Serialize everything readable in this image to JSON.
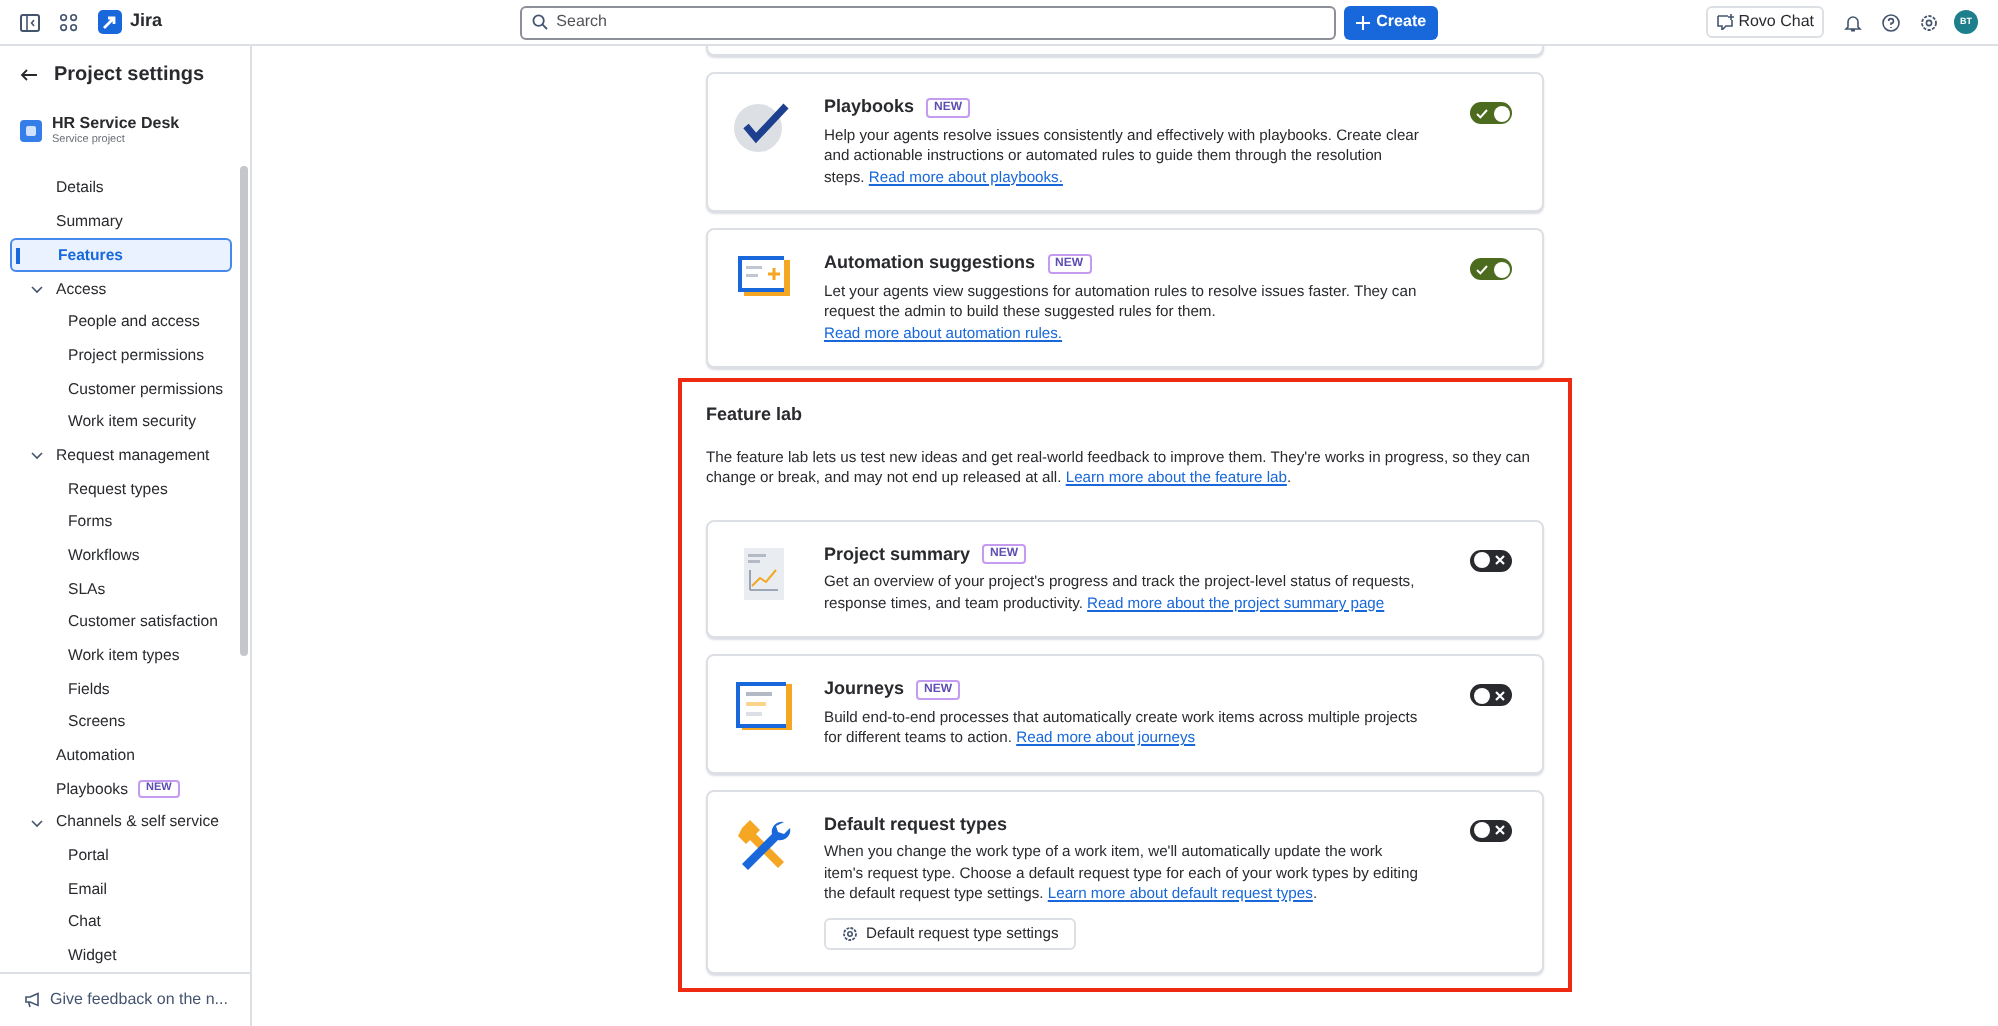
{
  "topbar": {
    "product": "Jira",
    "search": {
      "placeholder": "Search"
    },
    "create_button": "Create",
    "chat_button": "Rovo Chat",
    "avatar": "BT"
  },
  "sidebar": {
    "back_title": "Project settings",
    "project": {
      "name": "HR Service Desk",
      "type": "Service project"
    },
    "items": [
      {
        "label": "Details",
        "selected": false
      },
      {
        "label": "Summary",
        "selected": false
      },
      {
        "label": "Features",
        "selected": true
      },
      {
        "label": "Access",
        "selected": false,
        "expanded": true,
        "children": [
          {
            "label": "People and access",
            "selected": false
          },
          {
            "label": "Project permissions",
            "selected": false
          },
          {
            "label": "Customer permissions",
            "selected": false
          },
          {
            "label": "Work item security",
            "selected": false
          }
        ]
      },
      {
        "label": "Request management",
        "selected": false,
        "expanded": true,
        "children": [
          {
            "label": "Request types",
            "selected": false
          },
          {
            "label": "Forms",
            "selected": false
          },
          {
            "label": "Workflows",
            "selected": false
          },
          {
            "label": "SLAs",
            "selected": false
          },
          {
            "label": "Customer satisfaction",
            "selected": false
          },
          {
            "label": "Work item types",
            "selected": false
          },
          {
            "label": "Fields",
            "selected": false
          },
          {
            "label": "Screens",
            "selected": false
          }
        ]
      },
      {
        "label": "Automation",
        "selected": false
      },
      {
        "label": "Playbooks",
        "selected": false,
        "badge": "NEW"
      },
      {
        "label": "Channels & self service",
        "selected": false,
        "expanded": true,
        "children": [
          {
            "label": "Portal",
            "selected": false
          },
          {
            "label": "Email",
            "selected": false
          },
          {
            "label": "Chat",
            "selected": false
          },
          {
            "label": "Widget",
            "selected": false
          }
        ]
      }
    ],
    "feedback": "Give feedback on the n..."
  },
  "features": [
    {
      "title": "Playbooks",
      "badge": "NEW",
      "description": "Help your agents resolve issues consistently and effectively with playbooks. Create clear and actionable instructions or automated rules to guide them through the resolution steps. ",
      "link": "Read more about playbooks.",
      "on": true
    },
    {
      "title": "Automation suggestions",
      "badge": "NEW",
      "description": "Let your agents view suggestions for automation rules to resolve issues faster. They can request the admin to build these suggested rules for them. ",
      "link": "Read more about automation rules.",
      "on": true
    }
  ],
  "feature_lab": {
    "title": "Feature lab",
    "highlighted": true,
    "description": "The feature lab lets us test new ideas and get real-world feedback to improve them. They're works in progress, so they can change or break, and may not end up released at all. ",
    "link": "Learn more about the feature lab",
    "link_suffix": ".",
    "items": [
      {
        "title": "Project summary",
        "badge": "NEW",
        "description": "Get an overview of your project's progress and track the project-level status of requests, response times, and team productivity. ",
        "link": "Read more about the project summary page",
        "on": false
      },
      {
        "title": "Journeys",
        "badge": "NEW",
        "description": "Build end-to-end processes that automatically create work items across multiple projects for different teams to action. ",
        "link": "Read more about journeys",
        "on": false
      },
      {
        "title": "Default request types",
        "description": "When you change the work type of a work item, we'll automatically update the work item's request type. Choose a default request type for each of your work types by editing the default request type settings. ",
        "link": "Learn more about default request types",
        "link_suffix": ".",
        "button": "Default request type settings",
        "on": false
      }
    ]
  }
}
